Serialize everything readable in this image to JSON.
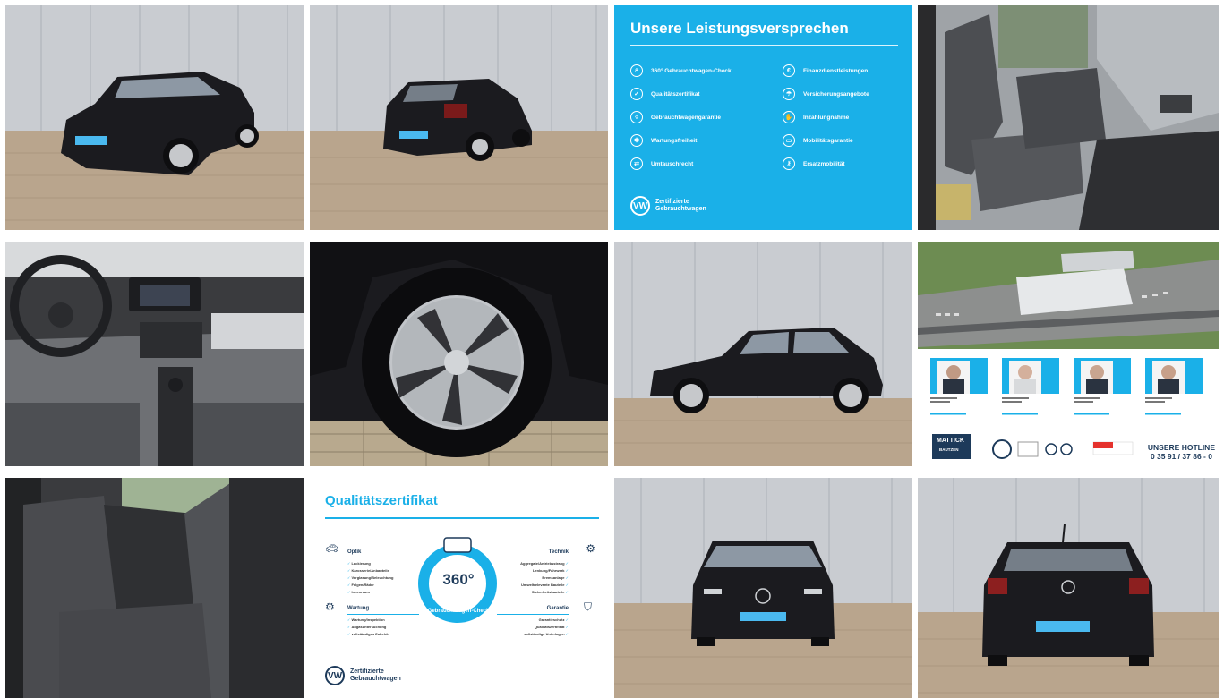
{
  "gallery": {
    "photos": [
      {
        "name": "front-left-exterior"
      },
      {
        "name": "rear-left-exterior"
      },
      {
        "name": "front-interior"
      },
      {
        "name": "dashboard"
      },
      {
        "name": "wheel"
      },
      {
        "name": "side-profile"
      },
      {
        "name": "dealership-aerial"
      },
      {
        "name": "rear-seats"
      },
      {
        "name": "front-exterior"
      },
      {
        "name": "rear-exterior"
      }
    ]
  },
  "info_card": {
    "title": "Unsere Leistungsversprechen",
    "items_left": [
      {
        "label": "360° Gebrauchtwagen-Check",
        "icon": "search-icon"
      },
      {
        "label": "Qualitätszertifikat",
        "icon": "certificate-icon"
      },
      {
        "label": "Gebrauchtwagengarantie",
        "icon": "shield-icon"
      },
      {
        "label": "Wartungsfreiheit",
        "icon": "wrench-icon"
      },
      {
        "label": "Umtauschrecht",
        "icon": "car-swap-icon"
      }
    ],
    "items_right": [
      {
        "label": "Finanzdienstleistungen",
        "icon": "money-icon"
      },
      {
        "label": "Versicherungsangebote",
        "icon": "umbrella-icon"
      },
      {
        "label": "Inzahlungnahme",
        "icon": "hand-car-icon"
      },
      {
        "label": "Mobilitätsgarantie",
        "icon": "car-icon"
      },
      {
        "label": "Ersatzmobilität",
        "icon": "key-icon"
      }
    ],
    "brand_line1": "Zertifizierte",
    "brand_line2": "Gebrauchtwagen"
  },
  "cert_card": {
    "title": "Qualitätszertifikat",
    "badge_number": "360°",
    "badge_text": "Gebrauchtwagen-Check",
    "sections": {
      "optik": {
        "title": "Optik",
        "items": [
          "Lackierung",
          "Karosserie/Anbauteile",
          "Verglasung/Beleuchtung",
          "Felgen/Räder",
          "Innenraum"
        ]
      },
      "technik": {
        "title": "Technik",
        "items": [
          "Aggregate/Antriebsstrang",
          "Lenkung/Fahrwerk",
          "Bremsanlage",
          "Umweltrelevante Bauteile",
          "Sicherheitsbauteile"
        ]
      },
      "wartung": {
        "title": "Wartung",
        "items": [
          "Wartung/Inspektion",
          "Abgasuntersuchung",
          "vollständiges Zubehör"
        ]
      },
      "garantie": {
        "title": "Garantie",
        "items": [
          "Garantieschutz",
          "Qualitätszertifikat",
          "vollständige Unterlagen"
        ]
      }
    },
    "brand_line1": "Zertifizierte",
    "brand_line2": "Gebrauchtwagen"
  },
  "dealer_card": {
    "logo_name": "MATTICK",
    "logo_city": "BAUTZEN",
    "hotline_title": "UNSERE HOTLINE",
    "hotline_number": "0 35 91 / 37 86 - 0"
  },
  "colors": {
    "accent": "#1ab0e8",
    "navy": "#1d3a5a",
    "car_black": "#1b1b1f"
  }
}
